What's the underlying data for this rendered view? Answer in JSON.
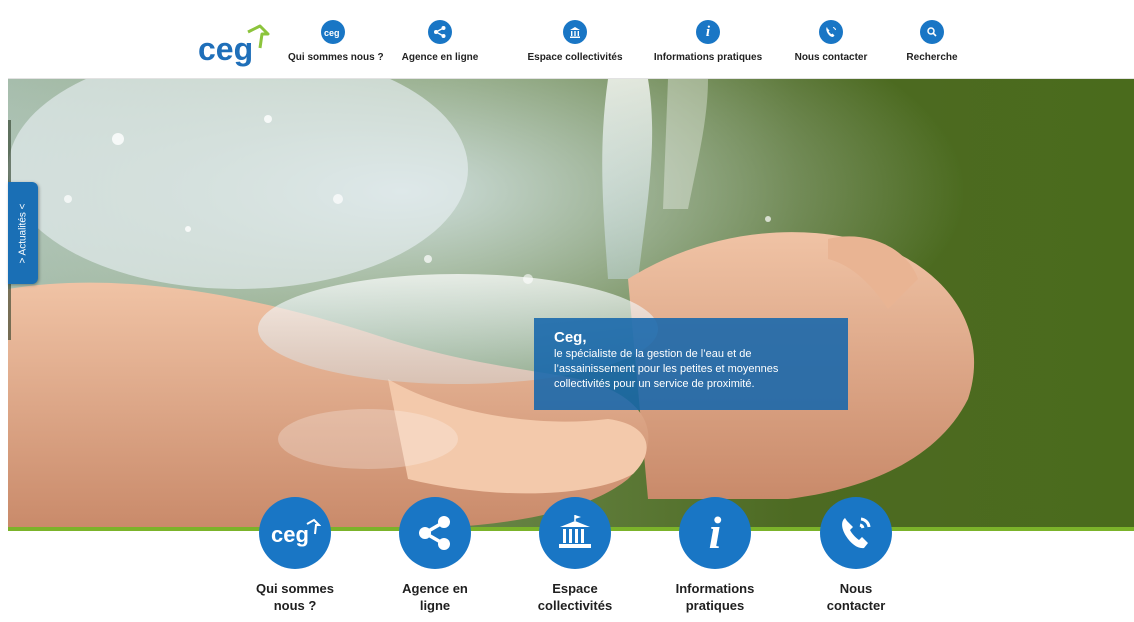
{
  "brand": {
    "logo_text": "ceg",
    "primary_color": "#1976c5",
    "accent_green": "#7bb32a"
  },
  "nav": [
    {
      "label": "Qui sommes nous ?",
      "icon": "ceg-logo-icon"
    },
    {
      "label": "Agence en ligne",
      "icon": "share-icon"
    },
    {
      "label": "Espace collectivités",
      "icon": "town-hall-icon"
    },
    {
      "label": "Informations pratiques",
      "icon": "info-icon"
    },
    {
      "label": "Nous contacter",
      "icon": "phone-icon"
    },
    {
      "label": "Recherche",
      "icon": "search-icon"
    }
  ],
  "side_tab": {
    "label": "> Actualités <"
  },
  "hero": {
    "title": "Ceg,",
    "text": "le spécialiste de la gestion de l’eau et de l’assainissement pour les petites et moyennes collectivités pour un service de proximité."
  },
  "quick_links": [
    {
      "label": "Qui sommes\nnous ?",
      "icon": "ceg-logo-icon"
    },
    {
      "label": "Agence en\nligne",
      "icon": "share-icon"
    },
    {
      "label": "Espace\ncollectivités",
      "icon": "town-hall-icon"
    },
    {
      "label": "Informations\npratiques",
      "icon": "info-icon"
    },
    {
      "label": "Nous\ncontacter",
      "icon": "phone-icon"
    }
  ]
}
